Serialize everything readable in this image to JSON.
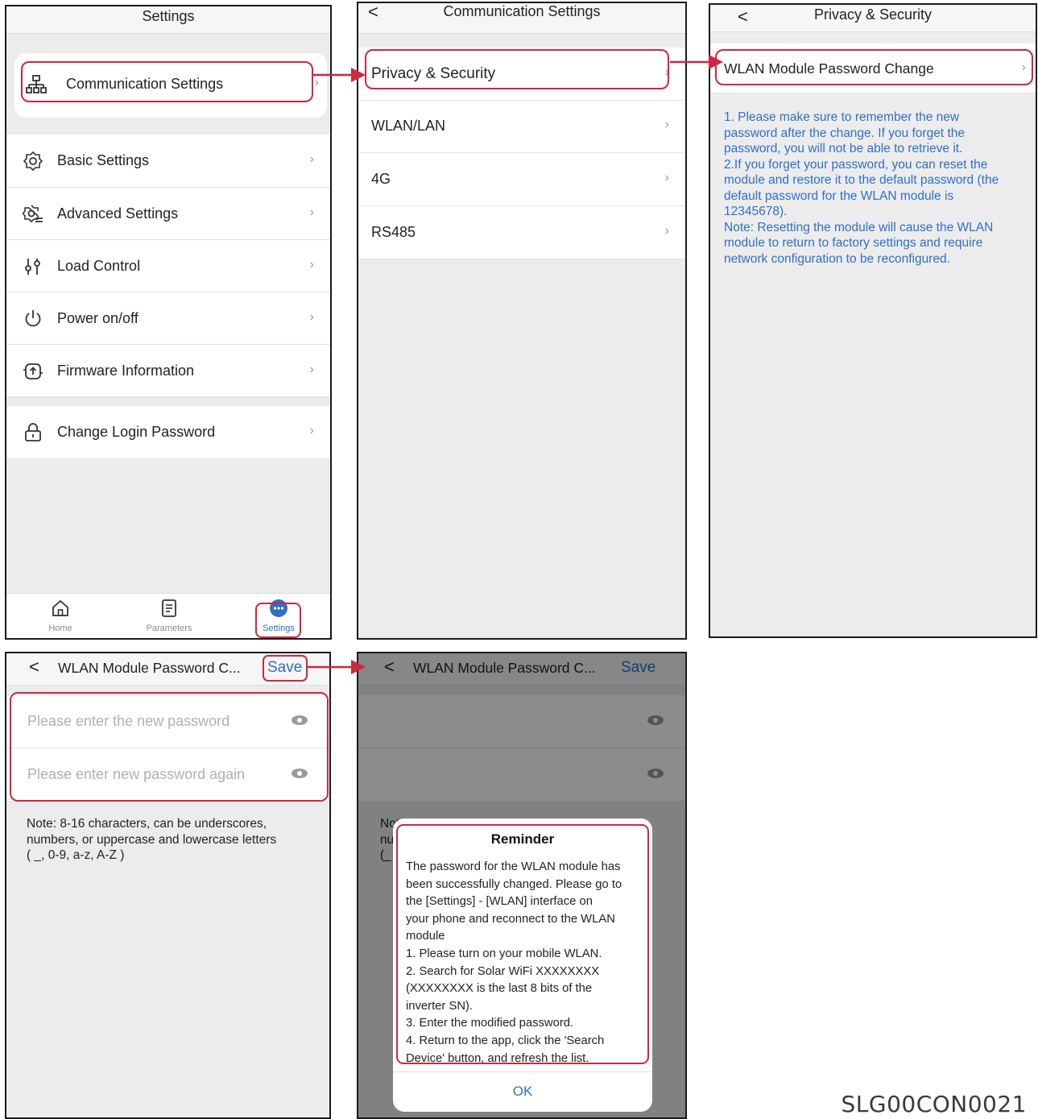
{
  "screen_settings": {
    "title": "Settings",
    "comm_item": "Communication Settings",
    "items": [
      {
        "label": "Basic Settings",
        "icon": "gear-icon"
      },
      {
        "label": "Advanced Settings",
        "icon": "advanced-gear-icon"
      },
      {
        "label": "Load Control",
        "icon": "sliders-icon"
      },
      {
        "label": "Power on/off",
        "icon": "power-icon"
      },
      {
        "label": "Firmware Information",
        "icon": "firmware-upload-icon"
      }
    ],
    "password_item": "Change Login Password",
    "tabs": [
      "Home",
      "Parameters",
      "Settings"
    ]
  },
  "screen_communication": {
    "back": "<",
    "title": "Communication Settings",
    "items": [
      "Privacy & Security",
      "WLAN/LAN",
      "4G",
      "RS485"
    ]
  },
  "screen_privacy": {
    "back": "<",
    "title": "Privacy & Security",
    "item": "WLAN Module Password Change",
    "note": "1. Please make sure to remember the new\npassword after the change. If you forget the\npassword, you will not be able to retrieve it.\n2.If you forget your password, you can reset the\nmodule and restore it to the default password (the\ndefault password for the WLAN module is\n12345678).\nNote: Resetting the module will cause the WLAN\nmodule to return to factory settings and require\nnetwork configuration to be reconfigured."
  },
  "screen_password": {
    "back": "<",
    "title": "WLAN Module Password C...",
    "save": "Save",
    "new_password_placeholder": "Please enter the new password",
    "repeat_password_placeholder": "Please enter new password again",
    "note": "Note: 8-16 characters, can be underscores,\nnumbers, or uppercase and lowercase letters\n( _, 0-9, a-z, A-Z )"
  },
  "screen_reminder": {
    "back": "<",
    "title": "WLAN Module Password C...",
    "save": "Save",
    "bg_note_fragments": [
      "Not",
      "nu",
      "(_"
    ],
    "dialog_title": "Reminder",
    "dialog_body": "The password for the WLAN module has\nbeen successfully changed. Please go to\nthe [Settings] - [WLAN] interface on\nyour phone and reconnect to the WLAN\nmodule\n1. Please turn on your mobile WLAN.\n2. Search for Solar WiFi XXXXXXXX\n(XXXXXXXX is the last 8 bits of the\ninverter SN).\n3. Enter the modified password.\n4. Return to the app, click the 'Search\nDevice' button, and refresh the list.",
    "ok": "OK"
  },
  "figure_code": "SLG00CON0021",
  "colors": {
    "highlight": "#d2263f",
    "link_blue": "#2f6fc8",
    "background": "#ececec"
  }
}
